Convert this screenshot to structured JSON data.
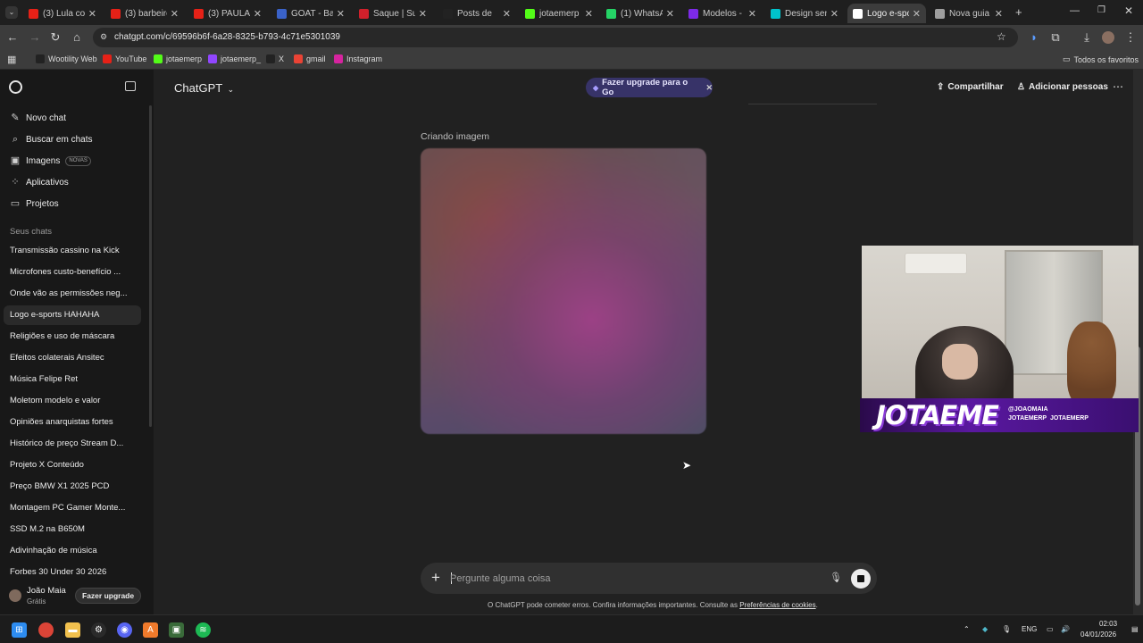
{
  "browser": {
    "tabs": [
      {
        "title": "(3) Lula cond",
        "icon": "youtube-icon",
        "color": "#e62117"
      },
      {
        "title": "(3) barbeiro",
        "icon": "youtube-icon",
        "color": "#e62117"
      },
      {
        "title": "(3) PAULA N",
        "icon": "youtube-icon",
        "color": "#e62117"
      },
      {
        "title": "GOAT - Batt",
        "icon": "goat-icon",
        "color": "#3a62c8"
      },
      {
        "title": "Saque | Sup",
        "icon": "s-logo-icon",
        "color": "#d1202b"
      },
      {
        "title": "Posts de",
        "icon": "x-logo-icon",
        "color": "#222222"
      },
      {
        "title": "jotaemerp S",
        "icon": "kick-icon",
        "color": "#53fc18"
      },
      {
        "title": "(1) WhatsAp",
        "icon": "whatsapp-icon",
        "color": "#25d366"
      },
      {
        "title": "Modelos - C",
        "icon": "canva-icon",
        "color": "#7d2ae8"
      },
      {
        "title": "Design sem",
        "icon": "canva-icon",
        "color": "#00c4cc"
      },
      {
        "title": "Logo e-spor",
        "icon": "chatgpt-icon",
        "color": "#ffffff",
        "active": true
      },
      {
        "title": "Nova guia",
        "icon": "chrome-icon",
        "color": "#9e9e9e"
      }
    ],
    "url": "chatgpt.com/c/69596b6f-6a28-8325-b793-4c71e5301039",
    "bookmarks": [
      {
        "label": "Wootility Web",
        "icon": "wooting-icon",
        "color": "#222222"
      },
      {
        "label": "YouTube",
        "icon": "youtube-icon",
        "color": "#e62117"
      },
      {
        "label": "jotaemerp",
        "icon": "kick-icon",
        "color": "#53fc18"
      },
      {
        "label": "jotaemerp_",
        "icon": "twitch-icon",
        "color": "#9146ff"
      },
      {
        "label": "X",
        "icon": "x-logo-icon",
        "color": "#222222"
      },
      {
        "label": "gmail",
        "icon": "gmail-icon",
        "color": "#ea4335"
      },
      {
        "label": "Instagram",
        "icon": "instagram-icon",
        "color": "#d6249f"
      }
    ],
    "all_bookmarks": "Todos os favoritos"
  },
  "sidebar": {
    "nav": [
      {
        "label": "Novo chat",
        "icon": "new-chat-icon"
      },
      {
        "label": "Buscar em chats",
        "icon": "search-icon"
      },
      {
        "label": "Imagens",
        "icon": "images-icon",
        "badge": "NOVAS"
      },
      {
        "label": "Aplicativos",
        "icon": "apps-icon"
      },
      {
        "label": "Projetos",
        "icon": "folder-icon"
      }
    ],
    "section_title": "Seus chats",
    "chats": [
      "Transmissão cassino na Kick",
      "Microfones custo-benefício ...",
      "Onde vão as permissões neg...",
      "Logo e-sports HAHAHA",
      "Religiões e uso de máscara",
      "Efeitos colaterais Ansitec",
      "Música Felipe Ret",
      "Moletom modelo e valor",
      "Opiniões anarquistas fortes",
      "Histórico de preço Stream D...",
      "Projeto X Conteúdo",
      "Preço BMW X1 2025 PCD",
      "Montagem PC Gamer Monte...",
      "SSD M.2 na B650M",
      "Adivinhação de música",
      "Forbes 30 Under 30 2026"
    ],
    "active_chat_index": 3,
    "user": {
      "name": "João Maia",
      "plan": "Grátis",
      "upgrade_label": "Fazer upgrade"
    }
  },
  "header": {
    "model": "ChatGPT",
    "upgrade_pill": "Fazer upgrade para o Go",
    "share": "Compartilhar",
    "add_people": "Adicionar pessoas"
  },
  "conversation": {
    "status": "Criando imagem"
  },
  "overlay": {
    "logo_text": "JOTAEME",
    "handles": [
      "@JOAOMAIA",
      "JOTAEMERP",
      "JOTAEMERP"
    ]
  },
  "composer": {
    "placeholder": "Pergunte alguma coisa",
    "disclaimer": "O ChatGPT pode cometer erros. Confira informações importantes. Consulte as",
    "cookie_link": "Preferências de cookies",
    "disclaimer_end": "."
  },
  "taskbar": {
    "language": "ENG",
    "time": "02:03",
    "date": "04/01/2026"
  }
}
